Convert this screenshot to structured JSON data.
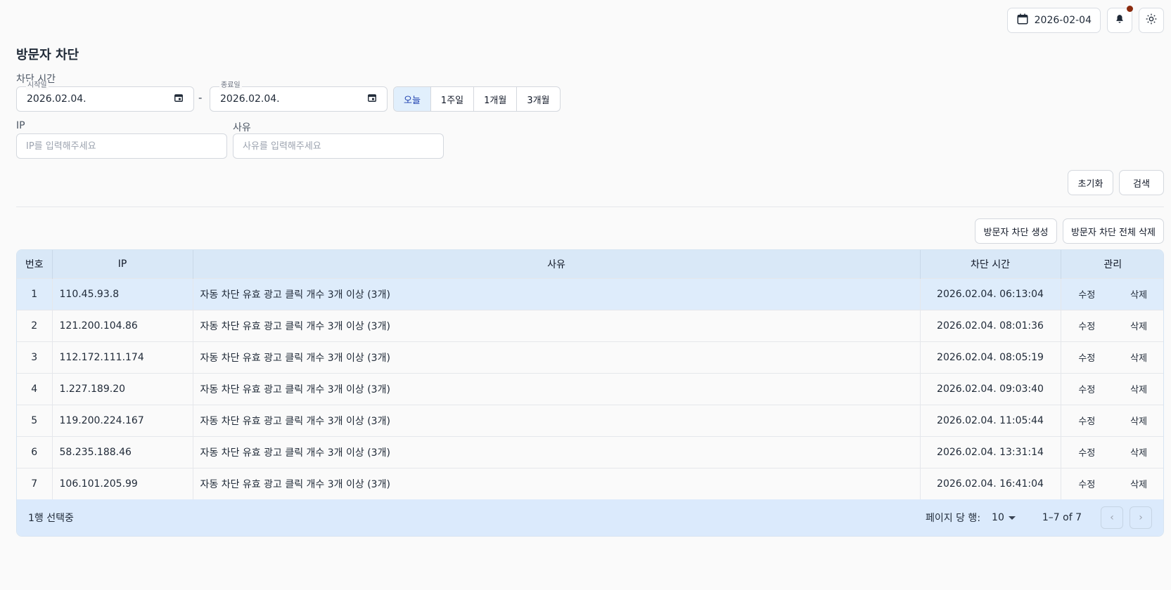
{
  "header": {
    "date": "2026-02-04"
  },
  "page": {
    "title": "방문자 차단",
    "time_section_label": "차단 시간"
  },
  "filters": {
    "start_label": "시작일",
    "start_value": "2026.02.04.",
    "end_label": "종료일",
    "end_value": "2026.02.04.",
    "separator": "-",
    "ranges": [
      "오늘",
      "1주일",
      "1개월",
      "3개월"
    ],
    "active_range": "오늘",
    "ip_label": "IP",
    "ip_placeholder": "IP를 입력해주세요",
    "reason_label": "사유",
    "reason_placeholder": "사유를 입력해주세요",
    "reset_label": "초기화",
    "search_label": "검색"
  },
  "actions": {
    "create_label": "방문자 차단 생성",
    "delete_all_label": "방문자 차단 전체 삭제"
  },
  "table": {
    "columns": [
      "번호",
      "IP",
      "사유",
      "차단 시간",
      "관리"
    ],
    "edit_label": "수정",
    "delete_label": "삭제",
    "rows": [
      {
        "no": "1",
        "ip": "110.45.93.8",
        "reason": "자동 차단 유효 광고 클릭 개수 3개 이상 (3개)",
        "time": "2026.02.04. 06:13:04"
      },
      {
        "no": "2",
        "ip": "121.200.104.86",
        "reason": "자동 차단 유효 광고 클릭 개수 3개 이상 (3개)",
        "time": "2026.02.04. 08:01:36"
      },
      {
        "no": "3",
        "ip": "112.172.111.174",
        "reason": "자동 차단 유효 광고 클릭 개수 3개 이상 (3개)",
        "time": "2026.02.04. 08:05:19"
      },
      {
        "no": "4",
        "ip": "1.227.189.20",
        "reason": "자동 차단 유효 광고 클릭 개수 3개 이상 (3개)",
        "time": "2026.02.04. 09:03:40"
      },
      {
        "no": "5",
        "ip": "119.200.224.167",
        "reason": "자동 차단 유효 광고 클릭 개수 3개 이상 (3개)",
        "time": "2026.02.04. 11:05:44"
      },
      {
        "no": "6",
        "ip": "58.235.188.46",
        "reason": "자동 차단 유효 광고 클릭 개수 3개 이상 (3개)",
        "time": "2026.02.04. 13:31:14"
      },
      {
        "no": "7",
        "ip": "106.101.205.99",
        "reason": "자동 차단 유효 광고 클릭 개수 3개 이상 (3개)",
        "time": "2026.02.04. 16:41:04"
      }
    ],
    "selected_row": "1"
  },
  "footer": {
    "selection_text": "1행 선택중",
    "rows_per_page_label": "페이지 당 행:",
    "rows_per_page_value": "10",
    "range_text": "1–7 of 7"
  },
  "colors": {
    "accent": "#1e40af",
    "selected_row": "#deecfb",
    "header_bg": "#d9e8f7",
    "notification_dot": "#8b2b0e"
  },
  "icons": [
    "calendar-icon",
    "bell-icon",
    "sun-icon",
    "calendar-picker-icon",
    "caret-down-icon",
    "chevron-left-icon",
    "chevron-right-icon"
  ]
}
